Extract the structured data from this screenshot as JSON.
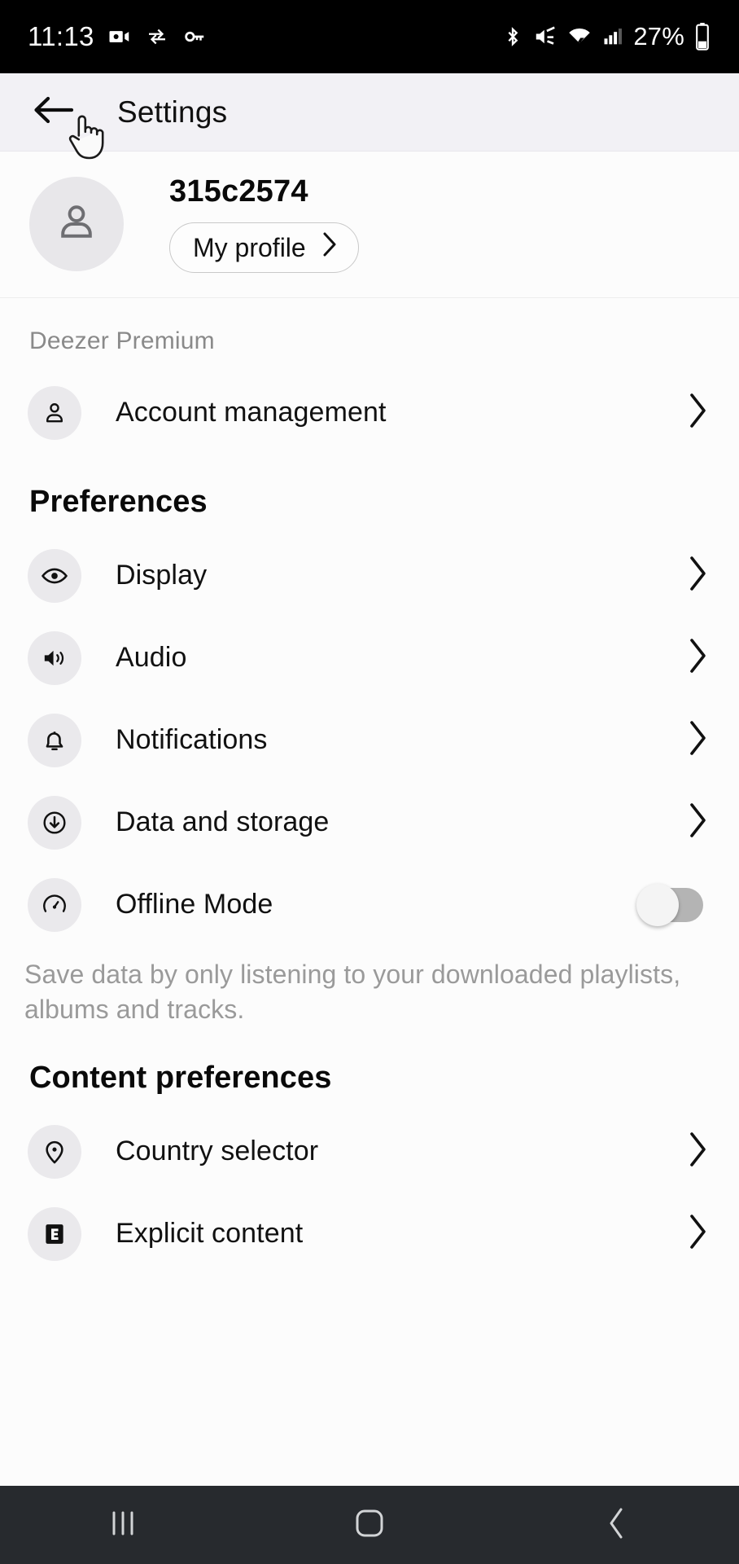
{
  "status_bar": {
    "time": "11:13",
    "battery_percent": "27%",
    "left_icons": [
      "video-camera-icon",
      "sync-transfer-icon",
      "key-icon"
    ],
    "right_icons": [
      "bluetooth-icon",
      "mute-icon",
      "wifi-icon",
      "cellular-signal-icon",
      "battery-icon"
    ]
  },
  "app_bar": {
    "back_icon": "arrow-left-icon",
    "title": "Settings"
  },
  "profile": {
    "avatar_icon": "person-avatar-icon",
    "username": "315c2574",
    "profile_button_label": "My profile",
    "profile_button_chevron": "chevron-right-icon"
  },
  "plan": {
    "label": "Deezer Premium",
    "account_row": {
      "icon": "person-icon",
      "label": "Account management",
      "chevron": "chevron-right-icon"
    }
  },
  "preferences": {
    "heading": "Preferences",
    "items": [
      {
        "icon": "eye-icon",
        "label": "Display",
        "control": "chevron-right-icon"
      },
      {
        "icon": "speaker-icon",
        "label": "Audio",
        "control": "chevron-right-icon"
      },
      {
        "icon": "bell-icon",
        "label": "Notifications",
        "control": "chevron-right-icon"
      },
      {
        "icon": "download-icon",
        "label": "Data and storage",
        "control": "chevron-right-icon"
      },
      {
        "icon": "offline-gauge-icon",
        "label": "Offline Mode",
        "control": "toggle-switch",
        "toggle_state": "off"
      }
    ],
    "offline_helper": "Save data by only listening to your downloaded playlists, albums and tracks."
  },
  "content_preferences": {
    "heading": "Content preferences",
    "items": [
      {
        "icon": "location-pin-icon",
        "label": "Country selector",
        "control": "chevron-right-icon"
      },
      {
        "icon": "explicit-badge-icon",
        "label": "Explicit content",
        "control": "chevron-right-icon"
      }
    ]
  },
  "nav_bar": {
    "recents": "recents-icon",
    "home": "home-icon",
    "back": "back-icon"
  },
  "colors": {
    "app_bar_bg": "#F2F1F5",
    "page_bg": "#FCFCFC",
    "icon_circle_bg": "#EAE9EC",
    "muted_text": "#8A8A8A",
    "nav_bar_bg": "#272A2E"
  }
}
